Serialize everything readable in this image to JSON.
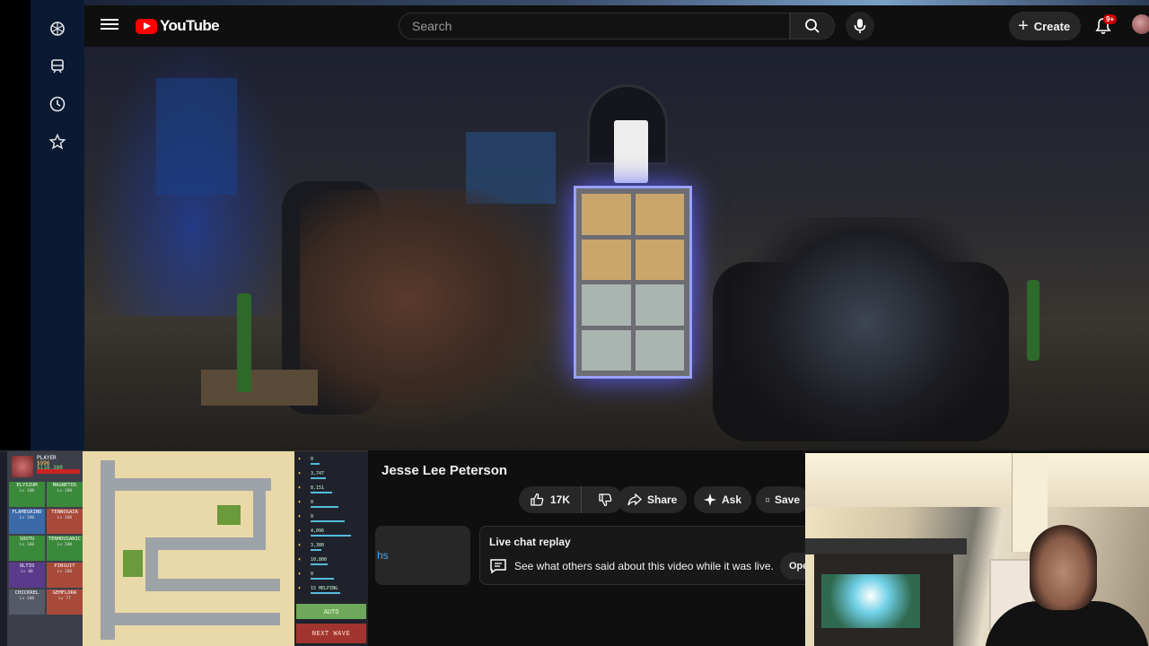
{
  "window": {
    "title": "YouTube"
  },
  "rail": {
    "icons": [
      "openai-icon",
      "train-icon",
      "clock-icon",
      "star-icon"
    ]
  },
  "header": {
    "logo_text": "YouTube",
    "search_placeholder": "Search",
    "create_label": "Create",
    "notification_badge": "9+"
  },
  "video": {
    "title_visible": "Jesse Lee Peterson",
    "like_count": "17K",
    "share_label": "Share",
    "ask_label": "Ask",
    "save_label": "Save",
    "description_fragment": "hs"
  },
  "live_chat": {
    "title": "Live chat replay",
    "description": "See what others said about this video while it was live.",
    "open_label": "Open"
  },
  "game": {
    "player_label": "PLAYER",
    "player_stat_1": "$996",
    "player_stat_2": "$118,380",
    "units": [
      {
        "name": "ELYSIUM",
        "level": "Lv 100",
        "color": "#3b8a3b"
      },
      {
        "name": "MAGNETOS",
        "level": "Lv 100",
        "color": "#3b8a3b"
      },
      {
        "name": "FLAMEGRIND",
        "level": "Lv 100",
        "color": "#3a6aa8"
      },
      {
        "name": "TENNOSAIR",
        "level": "Lv 100",
        "color": "#a84a3a"
      },
      {
        "name": "SOUTU",
        "level": "Lv 100",
        "color": "#3b8a3b"
      },
      {
        "name": "TENHOUSANIC",
        "level": "Lv 100",
        "color": "#3b8a3b"
      },
      {
        "name": "OLTIO",
        "level": "Lv 88",
        "color": "#5a3a8a"
      },
      {
        "name": "PINSUIT",
        "level": "Lv 100",
        "color": "#a84a3a"
      },
      {
        "name": "CHICKREL",
        "level": "Lv 100",
        "color": "#555a66"
      },
      {
        "name": "GEMFLORA",
        "level": "Lv 77",
        "color": "#a84a3a"
      }
    ],
    "stats": [
      "0",
      "3,747",
      "8,151",
      "0",
      "0",
      "4,096",
      "3,380",
      "10,800",
      "0",
      "15 HELPING"
    ],
    "auto_label": "AUTO",
    "next_wave_label": "NEXT WAVE"
  },
  "colors": {
    "accent_red": "#ff0000",
    "link_blue": "#3ea6ff",
    "rail_blue": "#0b1a33"
  }
}
